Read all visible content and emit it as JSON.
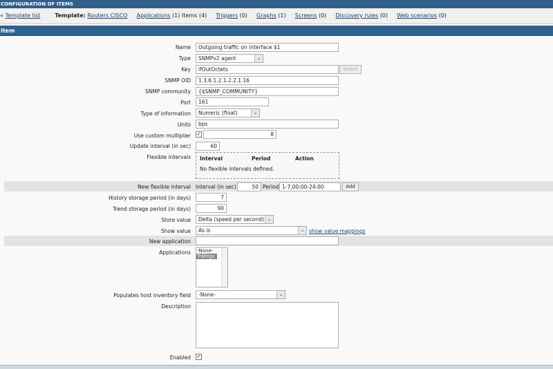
{
  "window": {
    "title": "CONFIGURATION OF ITEMS"
  },
  "nav": {
    "back_symbol": "«",
    "template_list": "Template list",
    "template_label": "Template:",
    "template_name": "Routers CISCO",
    "applications": "Applications",
    "applications_count": "(1)",
    "items": "Items (4)",
    "triggers": "Triggers",
    "triggers_count": "(0)",
    "graphs": "Graphs",
    "graphs_count": "(1)",
    "screens": "Screens",
    "screens_count": "(0)",
    "discovery": "Discovery rules",
    "discovery_count": "(0)",
    "web": "Web scenarios",
    "web_count": "(0)"
  },
  "section": {
    "title": "Item"
  },
  "form": {
    "name_label": "Name",
    "name_value": "Outgoing traffic on interface $1",
    "type_label": "Type",
    "type_value": "SNMPv2 agent",
    "key_label": "Key",
    "key_value": "ifOutOctets",
    "select_button": "Select",
    "oid_label": "SNMP OID",
    "oid_value": "1.3.6.1.2.1.2.2.1.16",
    "community_label": "SNMP community",
    "community_value": "{$SNMP_COMMUNITY}",
    "port_label": "Port",
    "port_value": "161",
    "info_label": "Type of information",
    "info_value": "Numeric (float)",
    "units_label": "Units",
    "units_value": "bps",
    "multiplier_label": "Use custom multiplier",
    "multiplier_checked": "✓",
    "multiplier_value": "8",
    "interval_label": "Update interval (in sec)",
    "interval_value": "60",
    "flex_label": "Flexible intervals",
    "flex_col_interval": "Interval",
    "flex_col_period": "Period",
    "flex_col_action": "Action",
    "flex_empty": "No flexible intervals defined.",
    "newflex_label": "New flexible interval",
    "newflex_interval_label": "Interval (in sec)",
    "newflex_interval_value": "50",
    "newflex_period_label": "Period",
    "newflex_period_value": "1-7,00:00-24:00",
    "add_button": "Add",
    "history_label": "History storage period (in days)",
    "history_value": "7",
    "trend_label": "Trend storage period (in days)",
    "trend_value": "90",
    "store_label": "Store value",
    "store_value": "Delta (speed per second)",
    "show_label": "Show value",
    "show_value": "As is",
    "show_mappings_link": "show value mappings",
    "newapp_label": "New application",
    "newapp_value": "",
    "apps_label": "Applications",
    "apps_options": [
      "-None-",
      "Tráfego"
    ],
    "inventory_label": "Populates host inventory field",
    "inventory_value": "-None-",
    "description_label": "Description",
    "description_value": "",
    "enabled_label": "Enabled",
    "enabled_checked": "✓"
  },
  "icons": {
    "dropdown": "chevron-down-icon",
    "check": "checkmark-icon"
  }
}
